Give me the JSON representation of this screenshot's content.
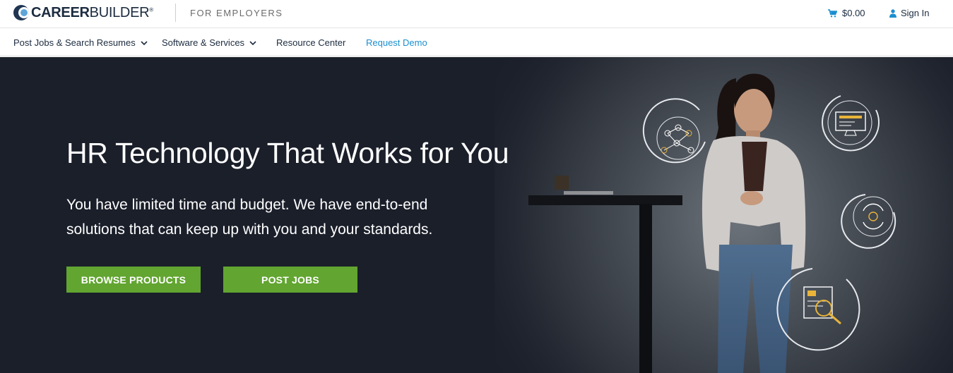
{
  "header": {
    "logo_text_bold": "CAREER",
    "logo_text_light": "BUILDER",
    "logo_registered": "®",
    "tagline": "FOR EMPLOYERS",
    "cart_amount": "$0.00",
    "sign_in": "Sign In"
  },
  "nav": {
    "items": [
      {
        "label": "Post Jobs & Search Resumes",
        "has_dropdown": true
      },
      {
        "label": "Software & Services",
        "has_dropdown": true
      },
      {
        "label": "Resource Center",
        "has_dropdown": false
      },
      {
        "label": "Request Demo",
        "has_dropdown": false
      }
    ]
  },
  "hero": {
    "title": "HR Technology That Works for You",
    "subtitle": "You have limited time and budget. We have end-to-end solutions that can keep up with you and your standards.",
    "buttons": {
      "browse": "BROWSE PRODUCTS",
      "post": "POST JOBS"
    }
  },
  "colors": {
    "accent_green": "#62a531",
    "accent_blue": "#1b8fcf",
    "hero_bg": "#1b1f2a",
    "brand_navy": "#1b2b3f"
  },
  "icons": [
    "logo-mark-icon",
    "cart-icon",
    "user-icon",
    "chevron-down-icon",
    "network-icon",
    "monitor-icon",
    "cycle-people-icon",
    "document-search-icon"
  ]
}
